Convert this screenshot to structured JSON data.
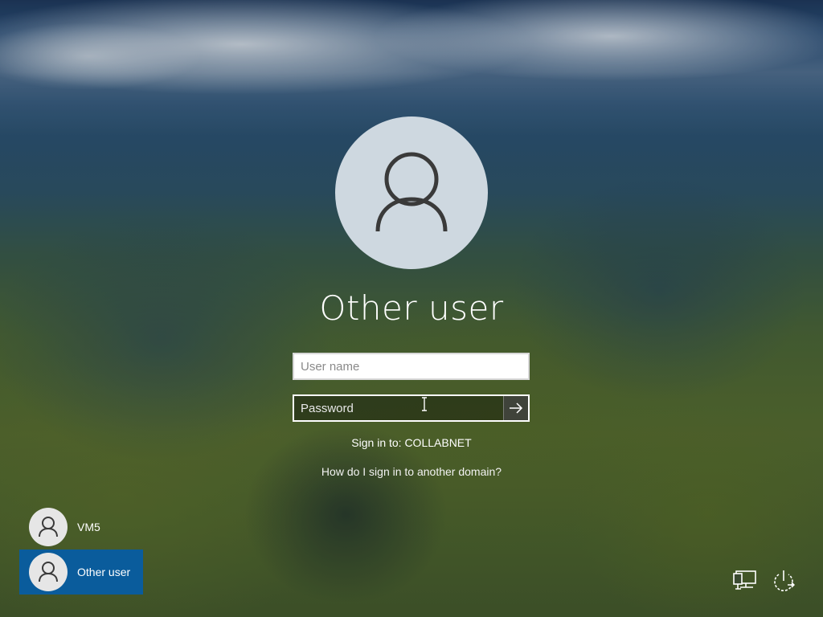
{
  "login": {
    "title": "Other user",
    "username_placeholder": "User name",
    "password_placeholder": "Password",
    "sign_in_to": "Sign in to: COLLABNET",
    "domain_help_link": "How do I sign in to another domain?"
  },
  "users": [
    {
      "label": "VM5",
      "selected": false,
      "icon": "user-avatar-icon"
    },
    {
      "label": "Other user",
      "selected": true,
      "icon": "user-avatar-icon"
    }
  ],
  "system_icons": [
    "network-icon",
    "power-icon"
  ],
  "colors": {
    "selected_tile": "#0a5c9c",
    "avatar_bg": "#ced8e0",
    "text": "#ffffff"
  }
}
